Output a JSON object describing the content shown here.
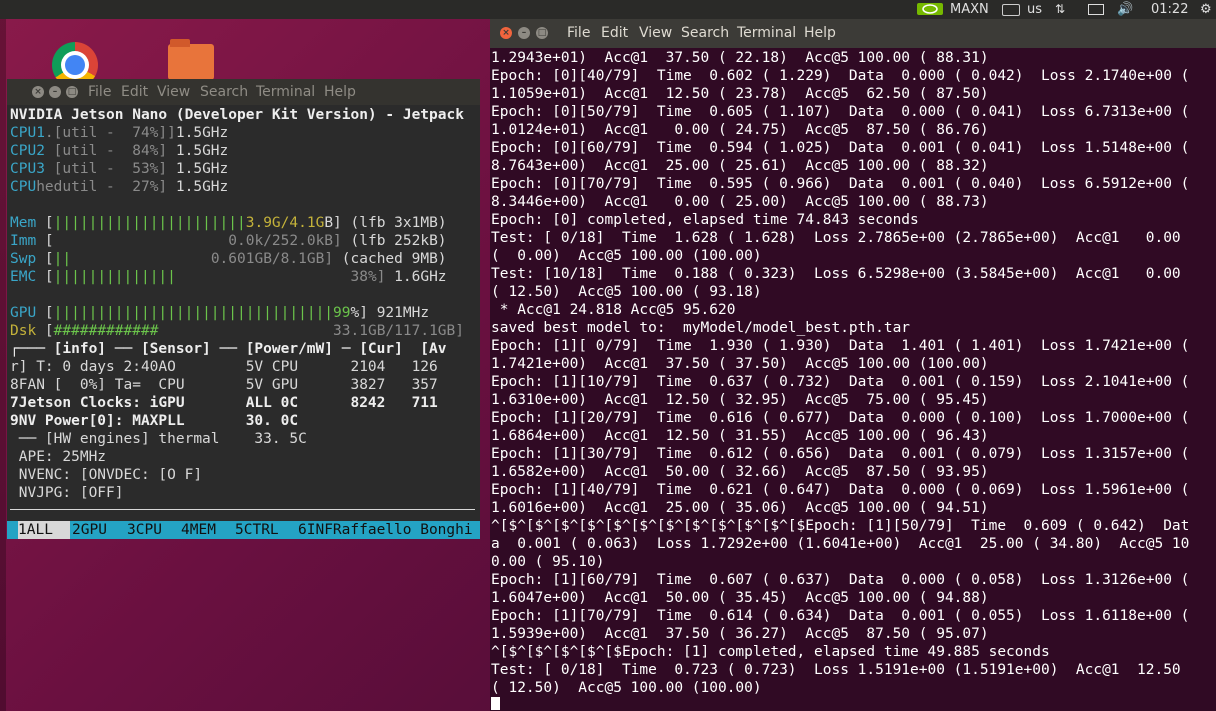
{
  "top_panel": {
    "nvidia_label": "MAXN",
    "keyboard_label": "us",
    "clock": "01:22"
  },
  "htop_window": {
    "menu": [
      "File",
      "Edit",
      "View",
      "Search",
      "Terminal",
      "Help"
    ],
    "header": "NVIDIA Jetson Nano (Developer Kit Version) - Jetpack",
    "cpus": [
      {
        "name": "CPU1",
        "bar": ".[util -  74%]]",
        "freq": "1.5GHz"
      },
      {
        "name": "CPU2",
        "bar": " [util -  84%]",
        "freq": "1.5GHz"
      },
      {
        "name": "CPU3",
        "bar": " [util -  53%]",
        "freq": "1.5GHz"
      },
      {
        "name": "CPU",
        "bar": "hedutil -  27%]",
        "freq": "1.5GHz"
      }
    ],
    "mem": {
      "label": "Mem",
      "bars": "||||||||||||||||||||||",
      "value": "3.9G/4.1G",
      "unit": "B]",
      "extra": "(lfb 3x1MB)"
    },
    "imm": {
      "label": "Imm",
      "value": "0.0k/252.0kB]",
      "extra": "(lfb 252kB)"
    },
    "swp": {
      "label": "Swp",
      "bars": "||",
      "value": "0.601GB/8.1GB]",
      "extra": "(cached 9MB)"
    },
    "emc": {
      "label": "EMC",
      "bars": "||||||||||||||",
      "value": "38%]",
      "extra": "1.6GHz"
    },
    "gpu": {
      "label": "GPU",
      "bars": "||||||||||||||||||||||||||||||||99",
      "value": "%]",
      "extra": "921MHz"
    },
    "dsk": {
      "label": "Dsk",
      "bars": "############",
      "value": "33.1GB/117.1GB]"
    },
    "info_header": "┌─── [info] ── [Sensor] ── [Power/mW] ─ [Cur]  [Av",
    "rows": [
      "r] T: 0 days 2:40AO        5V CPU      2104   126",
      "8FAN [  0%] Ta=  CPU       5V GPU      3827   357",
      "7Jetson Clocks: iGPU       ALL 0C      8242   711",
      "9NV Power[0]: MAXPLL       30. 0C",
      " ── [HW engines] thermal    33. 5C",
      " APE: 25MHz",
      " NVENC: [ONVDEC: [O F]",
      " NVJPG: [OFF]"
    ],
    "footer_tabs": [
      {
        "key": "1",
        "label": "ALL"
      },
      {
        "key": "2",
        "label": "GPU"
      },
      {
        "key": "3",
        "label": "CPU"
      },
      {
        "key": "4",
        "label": "MEM"
      },
      {
        "key": "5",
        "label": "CTRL"
      },
      {
        "key": "6",
        "label": "INFRaffaello Bonghi"
      }
    ]
  },
  "terminal_window": {
    "menu": [
      "File",
      "Edit",
      "View",
      "Search",
      "Terminal",
      "Help"
    ],
    "lines": [
      "1.2943e+01)  Acc@1  37.50 ( 22.18)  Acc@5 100.00 ( 88.31)",
      "Epoch: [0][40/79]  Time  0.602 ( 1.229)  Data  0.000 ( 0.042)  Loss 2.1740e+00 (",
      "1.1059e+01)  Acc@1  12.50 ( 23.78)  Acc@5  62.50 ( 87.50)",
      "Epoch: [0][50/79]  Time  0.605 ( 1.107)  Data  0.000 ( 0.041)  Loss 6.7313e+00 (",
      "1.0124e+01)  Acc@1   0.00 ( 24.75)  Acc@5  87.50 ( 86.76)",
      "Epoch: [0][60/79]  Time  0.594 ( 1.025)  Data  0.001 ( 0.041)  Loss 1.5148e+00 (",
      "8.7643e+00)  Acc@1  25.00 ( 25.61)  Acc@5 100.00 ( 88.32)",
      "Epoch: [0][70/79]  Time  0.595 ( 0.966)  Data  0.001 ( 0.040)  Loss 6.5912e+00 (",
      "8.3446e+00)  Acc@1   0.00 ( 25.00)  Acc@5 100.00 ( 88.73)",
      "Epoch: [0] completed, elapsed time 74.843 seconds",
      "Test: [ 0/18]  Time  1.628 ( 1.628)  Loss 2.7865e+00 (2.7865e+00)  Acc@1   0.00",
      "(  0.00)  Acc@5 100.00 (100.00)",
      "Test: [10/18]  Time  0.188 ( 0.323)  Loss 6.5298e+00 (3.5845e+00)  Acc@1   0.00",
      "( 12.50)  Acc@5 100.00 ( 93.18)",
      " * Acc@1 24.818 Acc@5 95.620",
      "saved best model to:  myModel/model_best.pth.tar",
      "Epoch: [1][ 0/79]  Time  1.930 ( 1.930)  Data  1.401 ( 1.401)  Loss 1.7421e+00 (",
      "1.7421e+00)  Acc@1  37.50 ( 37.50)  Acc@5 100.00 (100.00)",
      "Epoch: [1][10/79]  Time  0.637 ( 0.732)  Data  0.001 ( 0.159)  Loss 2.1041e+00 (",
      "1.6310e+00)  Acc@1  12.50 ( 32.95)  Acc@5  75.00 ( 95.45)",
      "Epoch: [1][20/79]  Time  0.616 ( 0.677)  Data  0.000 ( 0.100)  Loss 1.7000e+00 (",
      "1.6864e+00)  Acc@1  12.50 ( 31.55)  Acc@5 100.00 ( 96.43)",
      "Epoch: [1][30/79]  Time  0.612 ( 0.656)  Data  0.001 ( 0.079)  Loss 1.3157e+00 (",
      "1.6582e+00)  Acc@1  50.00 ( 32.66)  Acc@5  87.50 ( 93.95)",
      "Epoch: [1][40/79]  Time  0.621 ( 0.647)  Data  0.000 ( 0.069)  Loss 1.5961e+00 (",
      "1.6016e+00)  Acc@1  25.00 ( 35.06)  Acc@5 100.00 ( 94.51)",
      "^[$^[$^[$^[$^[$^[$^[$^[$^[$^[$^[$^[$Epoch: [1][50/79]  Time  0.609 ( 0.642)  Dat",
      "a  0.001 ( 0.063)  Loss 1.7292e+00 (1.6041e+00)  Acc@1  25.00 ( 34.80)  Acc@5 10",
      "0.00 ( 95.10)",
      "Epoch: [1][60/79]  Time  0.607 ( 0.637)  Data  0.000 ( 0.058)  Loss 1.3126e+00 (",
      "1.6047e+00)  Acc@1  50.00 ( 35.45)  Acc@5 100.00 ( 94.88)",
      "Epoch: [1][70/79]  Time  0.614 ( 0.634)  Data  0.001 ( 0.055)  Loss 1.6118e+00 (",
      "1.5939e+00)  Acc@1  37.50 ( 36.27)  Acc@5  87.50 ( 95.07)",
      "^[$^[$^[$^[$^[$Epoch: [1] completed, elapsed time 49.885 seconds",
      "Test: [ 0/18]  Time  0.723 ( 0.723)  Loss 1.5191e+00 (1.5191e+00)  Acc@1  12.50",
      "( 12.50)  Acc@5 100.00 (100.00)"
    ]
  }
}
